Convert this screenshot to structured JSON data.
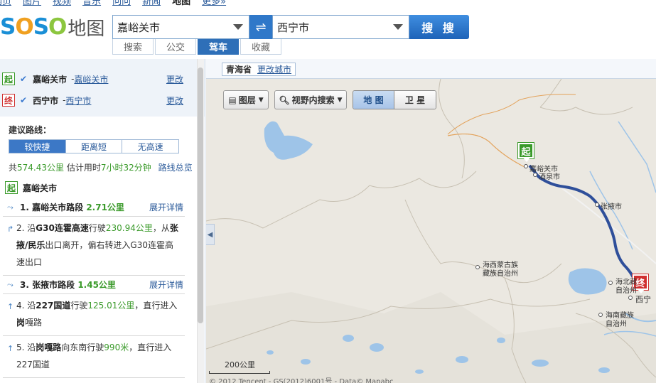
{
  "topnav": [
    "网页",
    "图片",
    "视频",
    "音乐",
    "问问",
    "新闻",
    "地图",
    "更多»"
  ],
  "topnav_current": "地图",
  "logo": {
    "s": "S",
    "o1": "O",
    "s2": "S",
    "o2": "O",
    "cn": "地图"
  },
  "search": {
    "from": "嘉峪关市",
    "to": "西宁市",
    "swap_icon": "⇌",
    "go_label": "搜 搜"
  },
  "modes": [
    {
      "label": "搜索",
      "active": false
    },
    {
      "label": "公交",
      "active": false
    },
    {
      "label": "驾车",
      "active": true
    },
    {
      "label": "收藏",
      "active": false
    }
  ],
  "endpoints": {
    "start": {
      "tag": "起",
      "name": "嘉峪关市",
      "sep": "-",
      "link": "嘉峪关市",
      "change": "更改"
    },
    "end": {
      "tag": "终",
      "name": "西宁市",
      "sep": "-",
      "link": "西宁市",
      "change": "更改"
    }
  },
  "advice_label": "建议路线：",
  "route_tabs": [
    {
      "label": "较快捷",
      "active": true
    },
    {
      "label": "距离短",
      "active": false
    },
    {
      "label": "无高速",
      "active": false
    }
  ],
  "summary": {
    "prefix": "共",
    "distance": "574.43公里",
    "time_prefix": "估计用时",
    "time": "7小时32分钟",
    "overview": "路线总览"
  },
  "start_row": {
    "tag": "起",
    "name": "嘉峪关市"
  },
  "steps": [
    {
      "kind": "head",
      "num": "1.",
      "title": "嘉峪关市路段",
      "dist": "2.71公里",
      "expand": "展开详情"
    },
    {
      "kind": "body",
      "text1": "2. 沿",
      "road": "G30连霍高速",
      "text2": "行驶",
      "dist": "230.94公里",
      "text3": "，从",
      "bold2": "张掖/民乐",
      "text4": "出口离开，偏右转进入G30连霍高速出口"
    },
    {
      "kind": "head",
      "num": "3.",
      "title": "张掖市路段",
      "dist": "1.45公里",
      "expand": "展开详情"
    },
    {
      "kind": "body",
      "text1": "4. 沿",
      "road": "227国道",
      "text2": "行驶",
      "dist": "125.01公里",
      "text3": "，直行进入",
      "bold2": "岗",
      "text4": "嘎路"
    },
    {
      "kind": "body",
      "text1": "5. 沿",
      "road": "岗嘎路",
      "text2": "向东南行驶",
      "dist": "990米",
      "text3": "，直行进入",
      "bold2": "",
      "text4": "227国道"
    }
  ],
  "map": {
    "province": "青海省",
    "change_city": "更改城市",
    "layers_btn": "图层",
    "view_search_btn": "视野内搜索",
    "map_toggle": "地 图",
    "sat_toggle": "卫 星",
    "scale_label": "200公里",
    "copyright": "© 2012 Tencent - GS(2012)6001号 - Data© Mapabc",
    "start_marker": "起",
    "end_marker": "终",
    "labels": {
      "jiayuguan": "嘉峪关市",
      "jiuquan": "酒泉市",
      "zhangye": "张掖市",
      "haixi": "海西蒙古族",
      "haixi2": "藏族自治州",
      "haibei": "海北藏",
      "haibei2": "自治州",
      "xining": "西宁",
      "hainan": "海南藏族",
      "hainan2": "自治州"
    },
    "route_color": "#2f4f9a"
  }
}
